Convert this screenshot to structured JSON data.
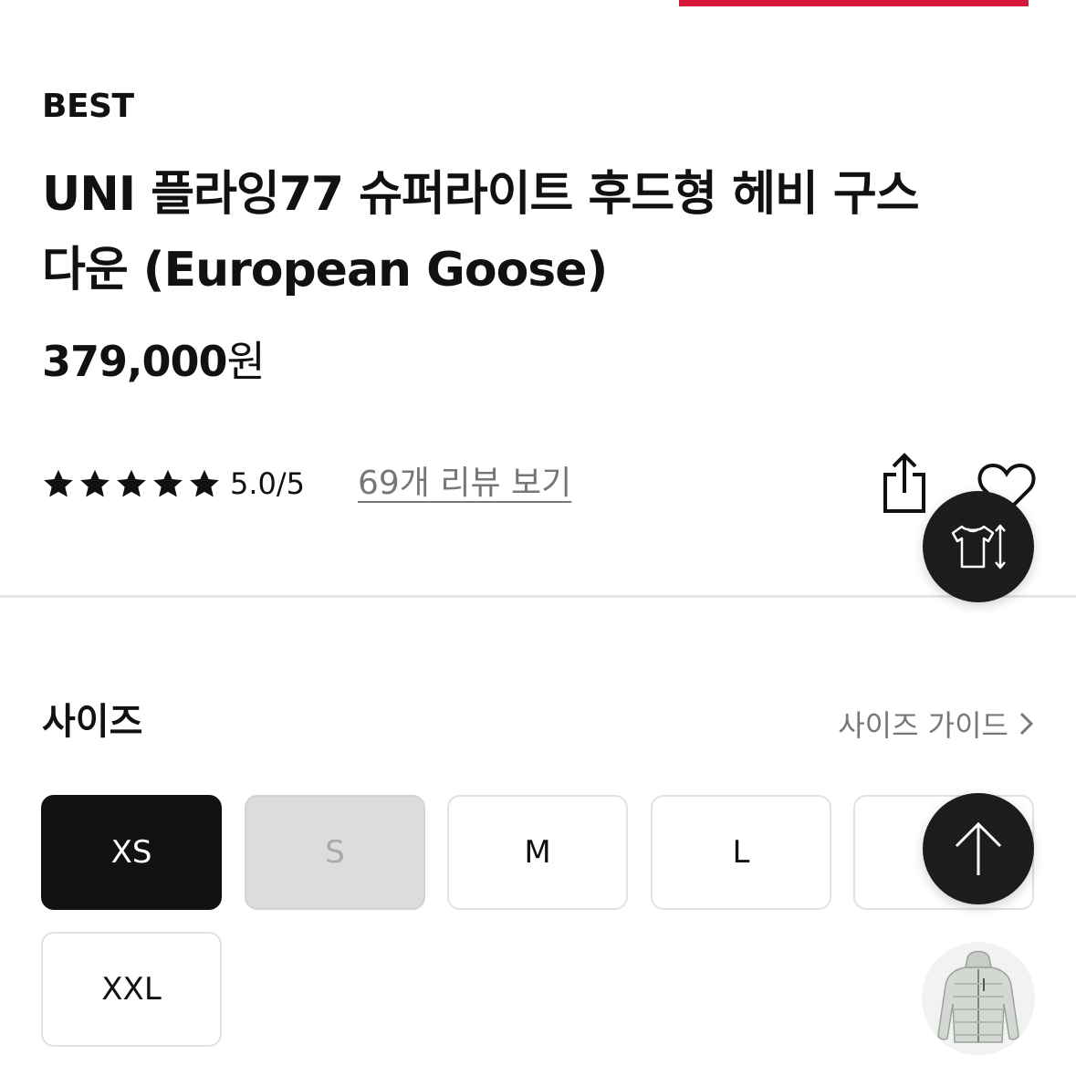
{
  "colors": {
    "accent_red": "#d6183a",
    "dark": "#111111",
    "muted": "#777777",
    "disabled_bg": "#dcdcdc"
  },
  "product": {
    "badge": "BEST",
    "title": "UNI 플라잉77 슈퍼라이트 후드형 헤비 구스다운 (European Goose)",
    "price_number": "379,000",
    "price_unit": "원"
  },
  "rating": {
    "stars": 5,
    "score_text": "5.0/5",
    "review_link": "69개 리뷰 보기"
  },
  "actions": {
    "share_icon": "share-icon",
    "wishlist_icon": "heart-icon"
  },
  "size_section": {
    "heading": "사이즈",
    "guide_label": "사이즈 가이드",
    "options": [
      {
        "label": "XS",
        "state": "selected"
      },
      {
        "label": "S",
        "state": "disabled"
      },
      {
        "label": "M",
        "state": "available"
      },
      {
        "label": "L",
        "state": "available"
      },
      {
        "label": "",
        "state": "available"
      },
      {
        "label": "XXL",
        "state": "available"
      }
    ]
  },
  "floating": {
    "size_fit_icon": "shirt-resize-icon",
    "scroll_top_icon": "arrow-up-icon",
    "product_thumbnail": "down-jacket-thumbnail"
  }
}
